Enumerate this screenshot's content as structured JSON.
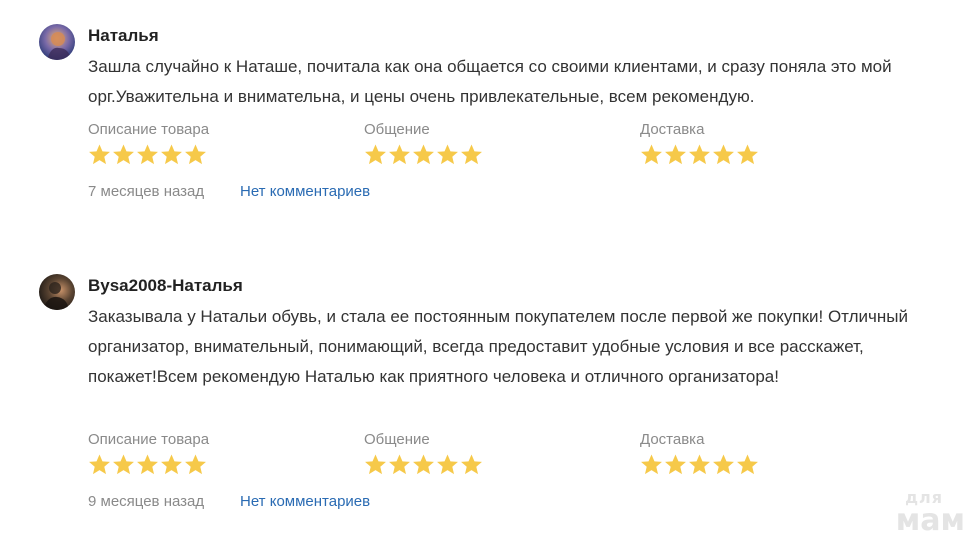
{
  "reviews": [
    {
      "author": "Наталья",
      "text": "Зашла случайно к Наташе, почитала как она общается со своими клиентами, и сразу поняла это мой орг.Уважительна и внимательна, и  цены очень привлекательные, всем рекомендую.",
      "ratings": [
        {
          "label": "Описание товара",
          "stars": 5
        },
        {
          "label": "Общение",
          "stars": 5
        },
        {
          "label": "Доставка",
          "stars": 5
        }
      ],
      "time": "7 месяцев назад",
      "comments_link": "Нет комментариев"
    },
    {
      "author": "Bysa2008-Наталья",
      "text": "Заказывала у Натальи обувь, и стала ее постоянным покупателем после первой же покупки! Отличный организатор, внимательный, понимающий, всегда предоставит удобные условия и все расскажет, покажет!Всем рекомендую Наталью как приятного человека и отличного организатора!",
      "ratings": [
        {
          "label": "Описание товара",
          "stars": 5
        },
        {
          "label": "Общение",
          "stars": 5
        },
        {
          "label": "Доставка",
          "stars": 5
        }
      ],
      "time": "9 месяцев назад",
      "comments_link": "Нет комментариев"
    }
  ],
  "watermark": {
    "line1": "для",
    "line2": "мам"
  },
  "colors": {
    "star": "#f6c94a",
    "link": "#2a6bb3",
    "muted": "#8a8a8a"
  }
}
